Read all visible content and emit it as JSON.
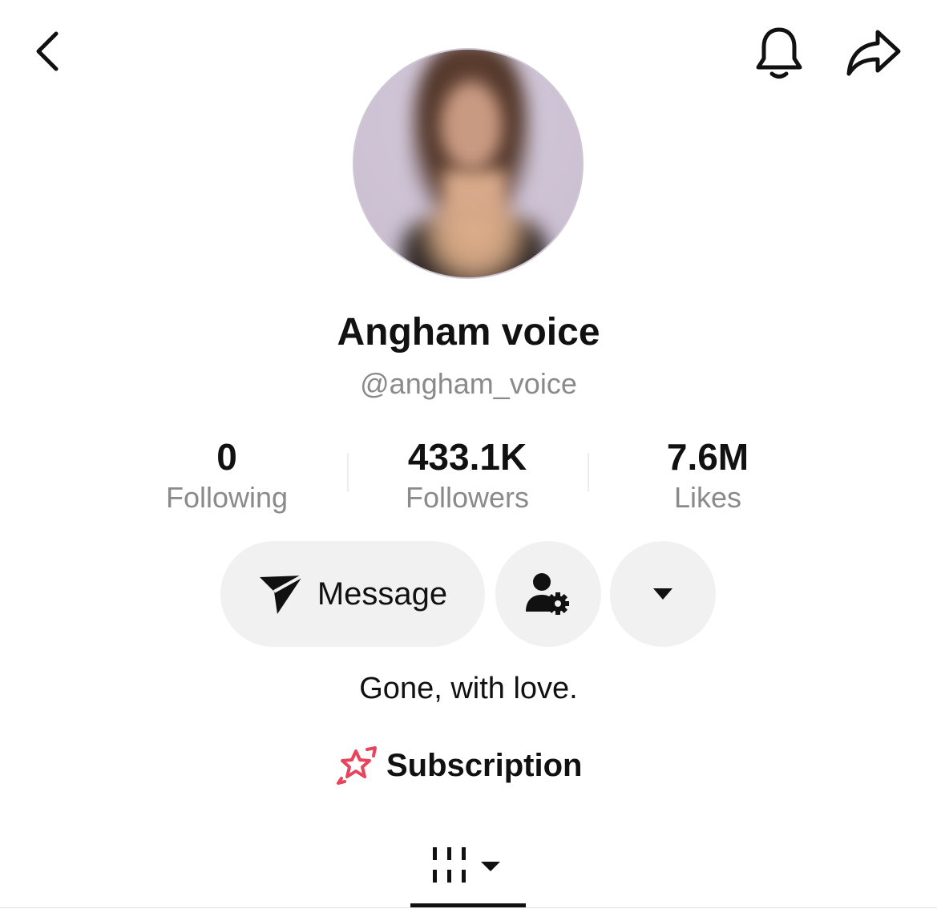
{
  "header": {
    "back_icon": "chevron-left-icon",
    "bell_icon": "bell-icon",
    "share_icon": "share-arrow-icon"
  },
  "profile": {
    "display_name": "Angham voice",
    "username": "@angham_voice",
    "bio": "Gone, with love."
  },
  "stats": {
    "following_count": "0",
    "following_label": "Following",
    "followers_count": "433.1K",
    "followers_label": "Followers",
    "likes_count": "7.6M",
    "likes_label": "Likes"
  },
  "actions": {
    "message_label": "Message",
    "message_icon": "paper-plane-icon",
    "follow_settings_icon": "user-gear-icon",
    "more_icon": "caret-down-icon"
  },
  "subscription": {
    "label": "Subscription",
    "icon": "star-rocket-icon",
    "icon_color": "#e8455c"
  },
  "tabs": {
    "videos_icon": "grid-bars-icon",
    "active_tab": "videos"
  },
  "colors": {
    "text_primary": "#111111",
    "text_secondary": "#8a8a8a",
    "button_bg": "#f1f1f1"
  }
}
